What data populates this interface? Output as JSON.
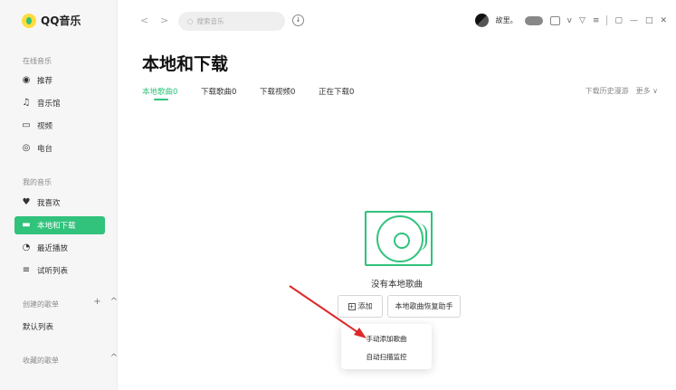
{
  "app": {
    "name": "QQ音乐"
  },
  "sidebar": {
    "online_section": "在线音乐",
    "online_items": [
      {
        "label": "推荐",
        "icon": "record-icon"
      },
      {
        "label": "音乐馆",
        "icon": "music-note-icon"
      },
      {
        "label": "视频",
        "icon": "video-icon"
      },
      {
        "label": "电台",
        "icon": "radio-icon"
      }
    ],
    "my_section": "我的音乐",
    "my_items": [
      {
        "label": "我喜欢",
        "icon": "heart-icon"
      },
      {
        "label": "本地和下载",
        "icon": "monitor-icon"
      },
      {
        "label": "最近播放",
        "icon": "clock-icon"
      },
      {
        "label": "试听列表",
        "icon": "playlist-icon"
      }
    ],
    "created_section": "创建的歌单",
    "default_list": "默认列表",
    "collected_section": "收藏的歌单"
  },
  "topbar": {
    "search_placeholder": "搜索音乐",
    "user_name": "故里。"
  },
  "main": {
    "title": "本地和下载",
    "tabs": [
      {
        "label": "本地歌曲0"
      },
      {
        "label": "下载歌曲0"
      },
      {
        "label": "下载视频0"
      },
      {
        "label": "正在下载0"
      }
    ],
    "right_links": {
      "history": "下载历史漫游",
      "more": "更多"
    },
    "empty_text": "没有本地歌曲",
    "add_button": "添加",
    "restore_button": "本地歌曲恢复助手",
    "dropdown": {
      "manual": "手动添加歌曲",
      "auto": "自动扫描监控"
    }
  },
  "colors": {
    "accent": "#31c27c",
    "arrow": "#e0282a"
  }
}
